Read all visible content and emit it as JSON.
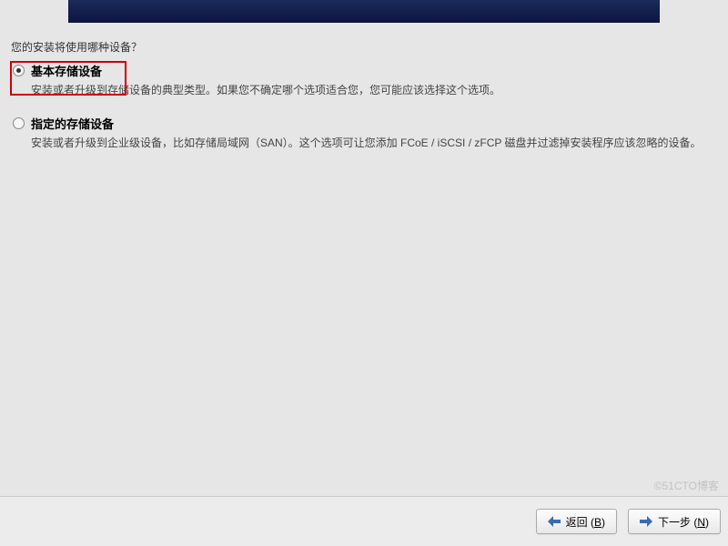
{
  "prompt": "您的安装将使用哪种设备？",
  "options": [
    {
      "title": "基本存储设备",
      "desc": "安装或者升级到存储设备的典型类型。如果您不确定哪个选项适合您，您可能应该选择这个选项。",
      "selected": true
    },
    {
      "title": "指定的存储设备",
      "desc": "安装或者升级到企业级设备，比如存储局域网（SAN）。这个选项可让您添加 FCoE / iSCSI / zFCP 磁盘并过滤掉安装程序应该忽略的设备。",
      "selected": false
    }
  ],
  "footer": {
    "back_label": "返回",
    "back_key": "B",
    "next_label": "下一步",
    "next_key": "N"
  },
  "watermark": "©51CTO博客"
}
